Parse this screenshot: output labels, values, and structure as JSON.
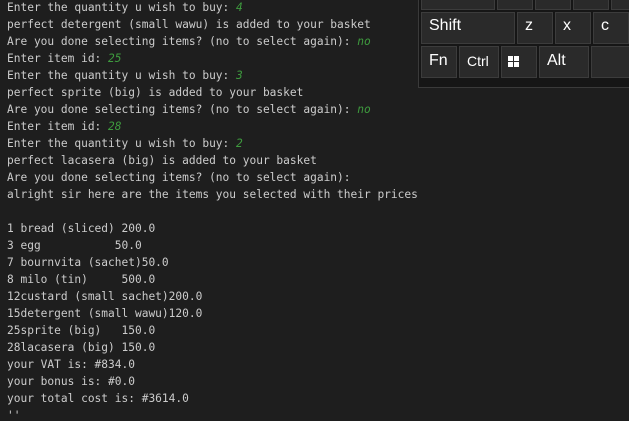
{
  "console": {
    "lines": [
      {
        "text": "Enter the quantity u wish to buy: ",
        "input": "4"
      },
      {
        "text": "perfect detergent (small wawu) is added to your basket",
        "input": ""
      },
      {
        "text": "Are you done selecting items? (no to select again): ",
        "input": "no"
      },
      {
        "text": "Enter item id: ",
        "input": "25"
      },
      {
        "text": "Enter the quantity u wish to buy: ",
        "input": "3"
      },
      {
        "text": "perfect sprite (big) is added to your basket",
        "input": ""
      },
      {
        "text": "Are you done selecting items? (no to select again): ",
        "input": "no"
      },
      {
        "text": "Enter item id: ",
        "input": "28"
      },
      {
        "text": "Enter the quantity u wish to buy: ",
        "input": "2"
      },
      {
        "text": "perfect lacasera (big) is added to your basket",
        "input": ""
      },
      {
        "text": "Are you done selecting items? (no to select again):",
        "input": ""
      },
      {
        "text": "alright sir here are the items you selected with their prices",
        "input": ""
      },
      {
        "text": "",
        "input": ""
      },
      {
        "text": "1 bread (sliced) 200.0",
        "input": ""
      },
      {
        "text": "3 egg           50.0",
        "input": ""
      },
      {
        "text": "7 bournvita (sachet)50.0",
        "input": ""
      },
      {
        "text": "8 milo (tin)     500.0",
        "input": ""
      },
      {
        "text": "12custard (small sachet)200.0",
        "input": ""
      },
      {
        "text": "15detergent (small wawu)120.0",
        "input": ""
      },
      {
        "text": "25sprite (big)   150.0",
        "input": ""
      },
      {
        "text": "28lacasera (big) 150.0",
        "input": ""
      },
      {
        "text": "your VAT is: #834.0",
        "input": ""
      },
      {
        "text": "your bonus is: #0.0",
        "input": ""
      },
      {
        "text": "your total cost is: #3614.0",
        "input": ""
      },
      {
        "text": "''",
        "input": ""
      }
    ]
  },
  "keyboard": {
    "keys": {
      "shift": "Shift",
      "z": "z",
      "x": "x",
      "c": "c",
      "fn": "Fn",
      "ctrl": "Ctrl",
      "win": "windows-icon",
      "alt": "Alt"
    }
  },
  "colors": {
    "background": "#1e1e1e",
    "text": "#cccccc",
    "user_input": "#3e9a3e"
  }
}
